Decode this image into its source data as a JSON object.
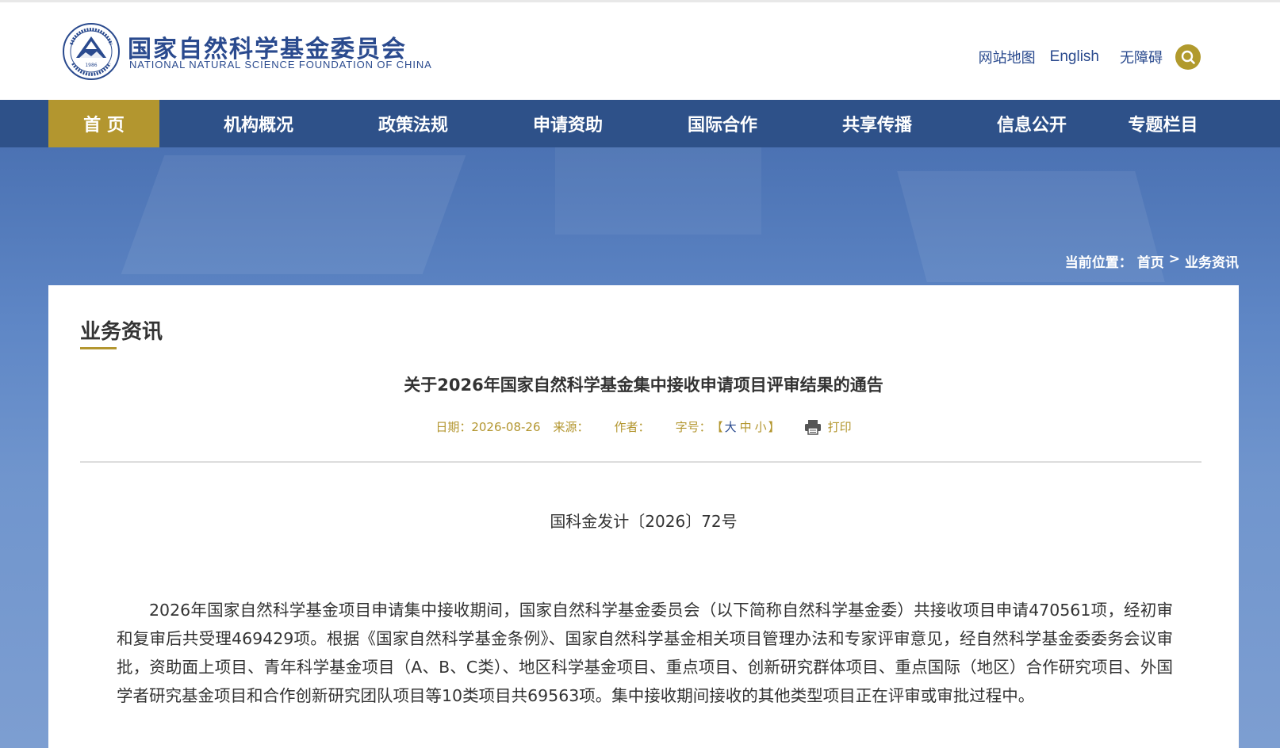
{
  "header": {
    "logo_cn": "国家自然科学基金委员会",
    "logo_en": "NATIONAL NATURAL SCIENCE FOUNDATION OF CHINA",
    "emblem_year": "1986",
    "links": {
      "sitemap": "网站地图",
      "english": "English",
      "accessibility": "无障碍"
    },
    "search_icon": "search-icon"
  },
  "nav": {
    "items": [
      {
        "label": "首 页",
        "active": true
      },
      {
        "label": "机构概况",
        "active": false
      },
      {
        "label": "政策法规",
        "active": false
      },
      {
        "label": "申请资助",
        "active": false
      },
      {
        "label": "国际合作",
        "active": false
      },
      {
        "label": "共享传播",
        "active": false
      },
      {
        "label": "信息公开",
        "active": false
      },
      {
        "label": "专题栏目",
        "active": false
      }
    ]
  },
  "breadcrumb": {
    "prefix": "当前位置：",
    "home": "首页",
    "separator": ">",
    "current": "业务资讯"
  },
  "section": {
    "title": "业务资讯"
  },
  "article": {
    "title": "关于2026年国家自然科学基金集中接收申请项目评审结果的通告",
    "meta": {
      "date_label": "日期：",
      "date": "2026-08-26",
      "source_label": "来源：",
      "author_label": "作者：",
      "fontsize_label": "字号：",
      "bracket_open": "【",
      "size_large": "大",
      "size_medium": "中",
      "size_small": "小",
      "bracket_close": "】",
      "print_label": "打印"
    },
    "doc_number": "国科金发计〔2026〕72号",
    "body": "2026年国家自然科学基金项目申请集中接收期间，国家自然科学基金委员会（以下简称自然科学基金委）共接收项目申请470561项，经初审和复审后共受理469429项。根据《国家自然科学基金条例》、国家自然科学基金相关项目管理办法和专家评审意见，经自然科学基金委委务会议审批，资助面上项目、青年科学基金项目（A、B、C类）、地区科学基金项目、重点项目、创新研究群体项目、重点国际（地区）合作研究项目、外国学者研究基金项目和合作创新研究团队项目等10类项目共69563项。集中接收期间接收的其他类型项目正在评审或审批过程中。"
  },
  "colors": {
    "brand_blue": "#2a4a8e",
    "nav_bg": "#2e5189",
    "accent_gold": "#b3962f",
    "text_dark": "#333333"
  }
}
